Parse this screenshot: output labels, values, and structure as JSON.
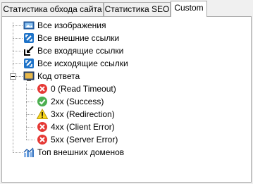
{
  "tabs": [
    {
      "label": "Статистика обхода сайта",
      "active": false
    },
    {
      "label": "Статистика SEO",
      "active": false
    },
    {
      "label": "Custom",
      "active": true
    }
  ],
  "tree": {
    "items": [
      {
        "label": "Все изображения",
        "icon": "images-icon"
      },
      {
        "label": "Все внешние ссылки",
        "icon": "external-links-icon"
      },
      {
        "label": "Все входящие ссылки",
        "icon": "incoming-links-icon"
      },
      {
        "label": "Все исходящие ссылки",
        "icon": "outgoing-links-icon"
      },
      {
        "label": "Код ответа",
        "icon": "response-code-icon",
        "expanded": true,
        "children": [
          {
            "label": "0 (Read Timeout)",
            "icon": "error-icon"
          },
          {
            "label": "2xx (Success)",
            "icon": "success-check-icon"
          },
          {
            "label": "3xx (Redirection)",
            "icon": "warning-icon"
          },
          {
            "label": "4xx (Client Error)",
            "icon": "error-icon"
          },
          {
            "label": "5xx (Server Error)",
            "icon": "error-icon"
          }
        ]
      },
      {
        "label": "Топ внешних доменов",
        "icon": "chart-icon"
      }
    ]
  },
  "colors": {
    "error": "#e53935",
    "success": "#4caf50",
    "warning": "#f9d71c",
    "link_blue": "#1e73c8"
  }
}
